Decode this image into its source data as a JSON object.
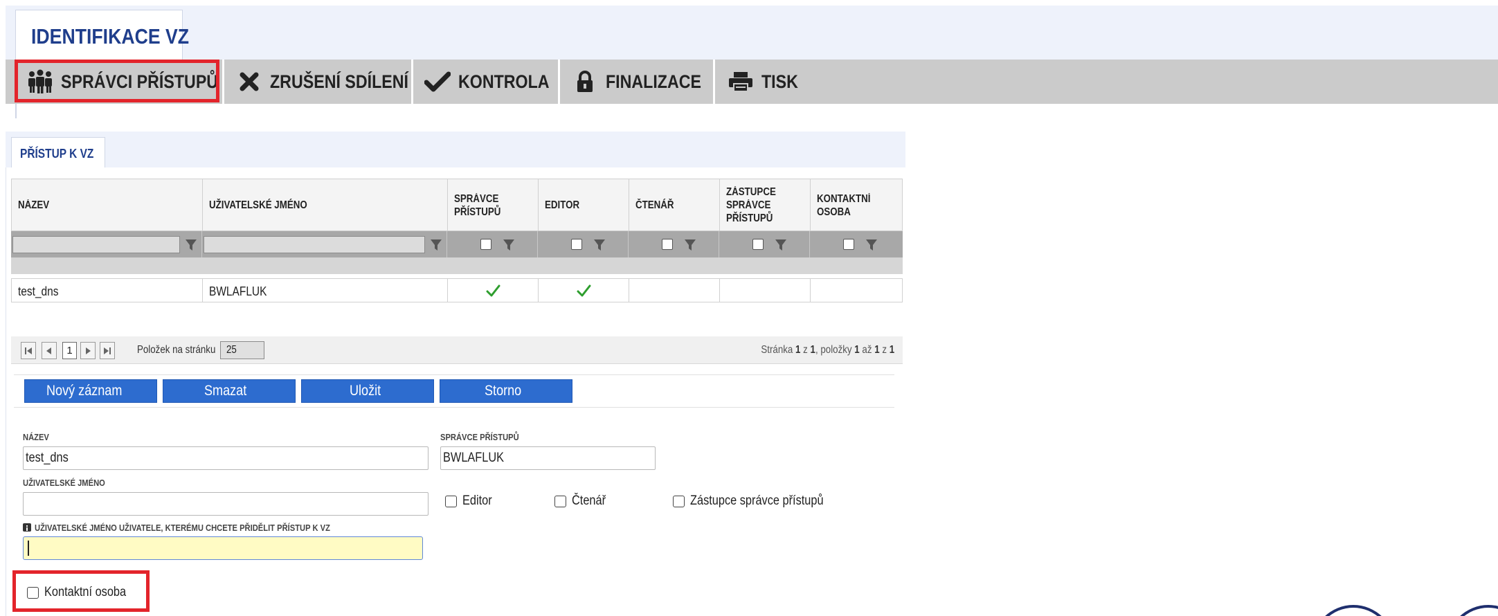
{
  "main_tab": {
    "label": "IDENTIFIKACE VZ"
  },
  "toolbar": {
    "buttons": [
      {
        "label": "SPRÁVCI PŘÍSTUPŮ",
        "icon": "users-icon"
      },
      {
        "label": "ZRUŠENÍ SDÍLENÍ",
        "icon": "close-icon"
      },
      {
        "label": "KONTROLA",
        "icon": "checkmark-icon"
      },
      {
        "label": "FINALIZACE",
        "icon": "lock-icon"
      },
      {
        "label": "TISK",
        "icon": "printer-icon"
      }
    ]
  },
  "panel": {
    "tab_label": "PŘÍSTUP K VZ"
  },
  "grid": {
    "columns": [
      {
        "l1": "NÁZEV",
        "l2": "",
        "l3": ""
      },
      {
        "l1": "UŽIVATELSKÉ JMÉNO",
        "l2": "",
        "l3": ""
      },
      {
        "l1": "SPRÁVCE",
        "l2": "PŘÍSTUPŮ",
        "l3": ""
      },
      {
        "l1": "EDITOR",
        "l2": "",
        "l3": ""
      },
      {
        "l1": "ČTENÁŘ",
        "l2": "",
        "l3": ""
      },
      {
        "l1": "ZÁSTUPCE",
        "l2": "SPRÁVCE",
        "l3": "PŘÍSTUPŮ"
      },
      {
        "l1": "KONTAKTNÍ",
        "l2": "OSOBA",
        "l3": ""
      }
    ],
    "rows": [
      {
        "nazev": "test_dns",
        "uzivatelske_jmeno": "BWLAFLUK",
        "spravce_pristupu": true,
        "editor": true,
        "ctenar": false,
        "zastupce": false,
        "kontaktni_osoba": false
      }
    ]
  },
  "pager": {
    "current_page": "1",
    "page_size_label": "Položek na stránku",
    "page_size": "25",
    "info_prefix": "Stránka",
    "page": "1",
    "of_word": "z",
    "pages": "1",
    "items_word": "položky",
    "from": "1",
    "to_word": "až",
    "to": "1",
    "of_word2": "z",
    "total": "1",
    "sep": ","
  },
  "actions": {
    "new": "Nový záznam",
    "delete": "Smazat",
    "save": "Uložit",
    "cancel": "Storno"
  },
  "form": {
    "nazev_label": "NÁZEV",
    "nazev_value": "test_dns",
    "spravce_label": "SPRÁVCE PŘÍSTUPŮ",
    "spravce_value": "BWLAFLUK",
    "username_label": "UŽIVATELSKÉ JMÉNO",
    "username_value": "",
    "editor_label": "Editor",
    "ctenar_label": "Čtenář",
    "zastupce_label": "Zástupce správce přístupů",
    "grant_label": "UŽIVATELSKÉ JMÉNO UŽIVATELE, KTERÉMU CHCETE PŘIDĚLIT PŘÍSTUP K VZ",
    "grant_value": "",
    "kontakt_label": "Kontaktní osoba"
  },
  "colors": {
    "accent_blue": "#2d6ccf",
    "title_blue": "#1f3e8c",
    "highlight_red": "#e3242b",
    "check_green": "#2e9e2e",
    "hint_yellow": "#fffbc4"
  }
}
